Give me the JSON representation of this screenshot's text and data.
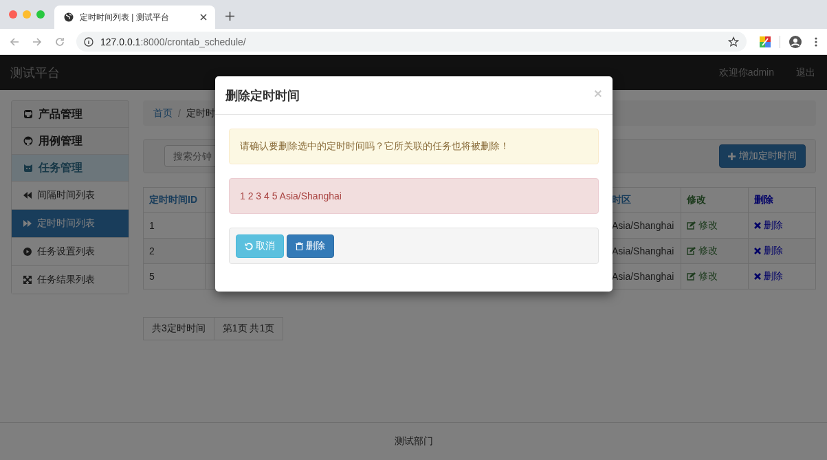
{
  "browser": {
    "tab_title": "定时时间列表 | 测试平台",
    "url_host": "127.0.0.1",
    "url_path": ":8000/crontab_schedule/"
  },
  "navbar": {
    "brand": "测试平台",
    "user": "欢迎你admin",
    "logout": "退出"
  },
  "sidebar": [
    {
      "label": "产品管理",
      "expanded": false
    },
    {
      "label": "用例管理",
      "expanded": false
    },
    {
      "label": "任务管理",
      "expanded": true,
      "children": [
        {
          "label": "间隔时间列表",
          "selected": false
        },
        {
          "label": "定时时间列表",
          "selected": true
        },
        {
          "label": "任务设置列表",
          "selected": false
        },
        {
          "label": "任务结果列表",
          "selected": false
        }
      ]
    }
  ],
  "breadcrumb": {
    "separator": "/",
    "items": [
      "首页",
      "定时时"
    ]
  },
  "search": {
    "placeholder": "搜索分钟"
  },
  "add_button": "增加定时时间",
  "table": {
    "columns": [
      "定时时间ID",
      "时区",
      "修改",
      "删除"
    ],
    "rows": [
      {
        "id": "1",
        "timezone": "Asia/Shanghai",
        "edit": "修改",
        "delete": "删除"
      },
      {
        "id": "2",
        "timezone": "Asia/Shanghai",
        "edit": "修改",
        "delete": "删除"
      },
      {
        "id": "5",
        "timezone": "Asia/Shanghai",
        "edit": "修改",
        "delete": "删除"
      }
    ]
  },
  "pagination": [
    "共3定时时间",
    "第1页 共1页"
  ],
  "footer": "测试部门",
  "modal": {
    "title": "删除定时时间",
    "close": "×",
    "warning": "请确认要删除选中的定时时间吗？它所关联的任务也将被删除！",
    "details": "1 2 3 4 5 Asia/Shanghai",
    "buttons": [
      {
        "kind": "cancel",
        "label": "取消"
      },
      {
        "kind": "delete",
        "label": "删除"
      }
    ]
  }
}
